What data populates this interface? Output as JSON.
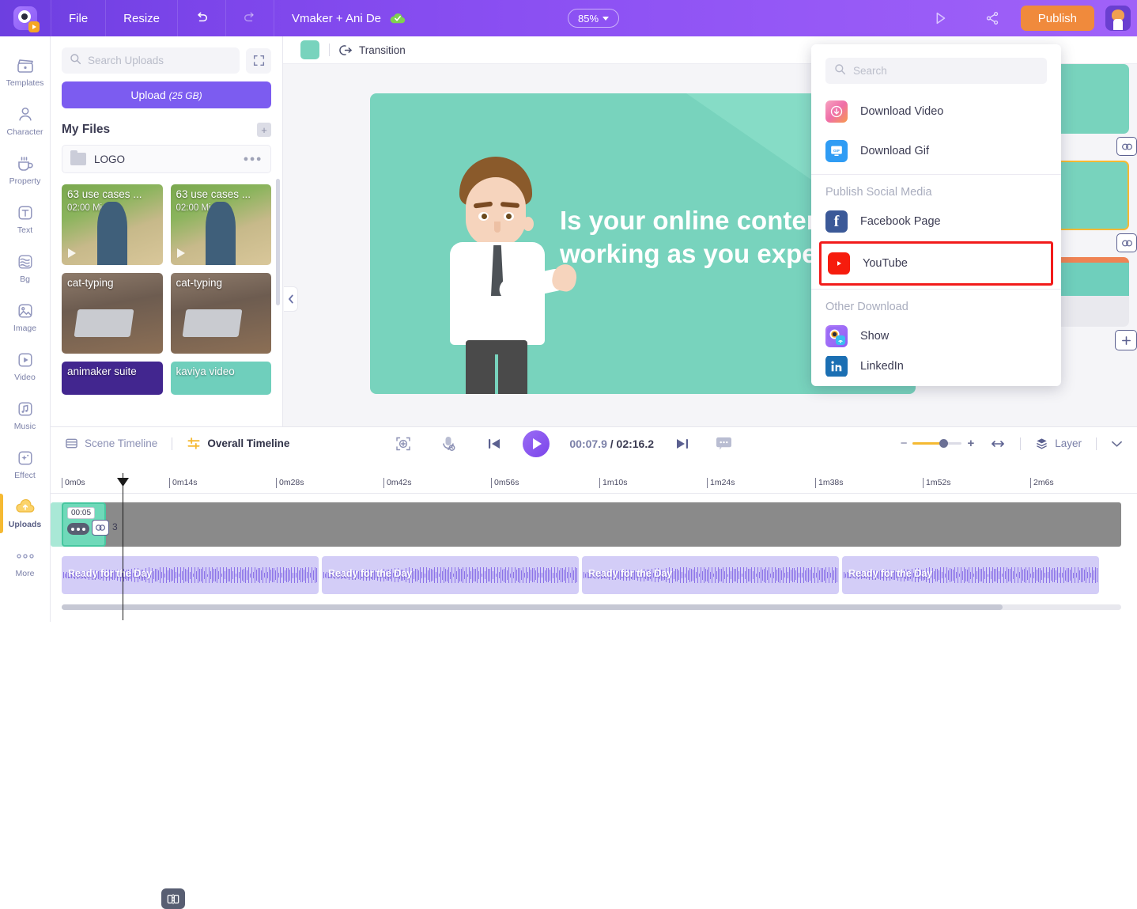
{
  "topbar": {
    "logo_name": "animaker-logo",
    "menu": [
      "File",
      "Resize"
    ],
    "undo_icon": "undo-icon",
    "redo_icon": "redo-icon",
    "project_title": "Vmaker + Ani De",
    "saved_icon": "cloud-saved-icon",
    "zoom_level": "85%",
    "preview_icon": "preview-play-icon",
    "share_icon": "share-icon",
    "publish_label": "Publish",
    "avatar": "user-avatar"
  },
  "rail": {
    "items": [
      {
        "label": "Templates",
        "icon": "templates-icon"
      },
      {
        "label": "Character",
        "icon": "character-icon"
      },
      {
        "label": "Property",
        "icon": "property-icon"
      },
      {
        "label": "Text",
        "icon": "text-icon"
      },
      {
        "label": "Bg",
        "icon": "background-icon"
      },
      {
        "label": "Image",
        "icon": "image-icon"
      },
      {
        "label": "Video",
        "icon": "video-icon"
      },
      {
        "label": "Music",
        "icon": "music-icon"
      },
      {
        "label": "Effect",
        "icon": "effect-icon"
      },
      {
        "label": "Uploads",
        "icon": "uploads-icon"
      },
      {
        "label": "More",
        "icon": "more-icon"
      }
    ],
    "active": "Uploads"
  },
  "uploads_panel": {
    "search_placeholder": "Search Uploads",
    "search_value": "",
    "expand_icon": "expand-icon",
    "upload_label": "Upload",
    "upload_quota": "(25 GB)",
    "my_files_title": "My Files",
    "add_folder_icon": "add-folder-icon",
    "folder": {
      "name": "LOGO",
      "menu_icon": "more-dots-icon"
    },
    "thumbnails": [
      {
        "title": "63 use cases ...",
        "sub": "02:00 Min.",
        "kind": "video"
      },
      {
        "title": "63 use cases ...",
        "sub": "02:00 Min.",
        "kind": "video"
      },
      {
        "title": "cat-typing",
        "sub": "",
        "kind": "video"
      },
      {
        "title": "cat-typing",
        "sub": "",
        "kind": "video"
      },
      {
        "title": "animaker suite",
        "sub": "",
        "kind": "image"
      },
      {
        "title": "kaviya video",
        "sub": "",
        "kind": "image"
      }
    ]
  },
  "stage": {
    "swatch_color": "#78d3bd",
    "transition_label": "Transition",
    "transition_icon": "transition-icon",
    "canvas_text": "Is your online content not working as you expect?",
    "canvas_bg": "#78d3bd",
    "collapse_icon": "chevron-left-icon"
  },
  "scenes": {
    "link_icon": "link-scenes-icon",
    "add_icon": "add-scene-icon",
    "cards": [
      "scene-1",
      "scene-2-selected",
      "scene-3"
    ]
  },
  "dropdown": {
    "search_placeholder": "Search",
    "search_value": "",
    "search_icon": "search-icon",
    "items_top": [
      {
        "label": "Download Video",
        "icon": "download-video-icon"
      },
      {
        "label": "Download Gif",
        "icon": "download-gif-icon"
      }
    ],
    "social_heading": "Publish Social Media",
    "social_items": [
      {
        "label": "Facebook Page",
        "icon": "facebook-icon"
      },
      {
        "label": "YouTube",
        "icon": "youtube-icon",
        "highlighted": true
      }
    ],
    "other_heading": "Other Download",
    "other_items": [
      {
        "label": "Show",
        "icon": "animaker-show-icon"
      },
      {
        "label": "LinkedIn",
        "icon": "linkedin-icon"
      }
    ],
    "highlight_color": "#f21b1b"
  },
  "timeline": {
    "scene_timeline_label": "Scene Timeline",
    "scene_timeline_icon": "scene-timeline-icon",
    "overall_timeline_label": "Overall Timeline",
    "overall_timeline_icon": "overall-timeline-icon",
    "fit_icon": "fit-to-screen-icon",
    "mic_icon": "record-voice-icon",
    "prev_icon": "previous-scene-icon",
    "play_icon": "play-icon",
    "next_icon": "next-scene-icon",
    "subtitle_icon": "subtitle-icon",
    "current_time": "00:07.9",
    "separator": "/",
    "total_time": "02:16.2",
    "zoom_minus": "−",
    "zoom_plus": "+",
    "fit_width_icon": "fit-width-icon",
    "layer_label": "Layer",
    "layer_icon": "layer-icon",
    "collapse_icon": "chevron-down-icon",
    "ruler_ticks": [
      "0m0s",
      "0m14s",
      "0m28s",
      "0m42s",
      "0m56s",
      "1m10s",
      "1m24s",
      "1m38s",
      "1m52s",
      "2m6s"
    ],
    "clip": {
      "duration_badge": "00:05",
      "dots_icon": "clip-options-icon",
      "link_icon": "clip-link-icon",
      "scene_number": "3"
    },
    "audio_clips": [
      {
        "name": "Ready for the Day"
      },
      {
        "name": "Ready for the Day"
      },
      {
        "name": "Ready for the Day"
      },
      {
        "name": "Ready for the Day"
      }
    ],
    "split_icon": "split-clip-icon",
    "playhead": "playhead"
  }
}
